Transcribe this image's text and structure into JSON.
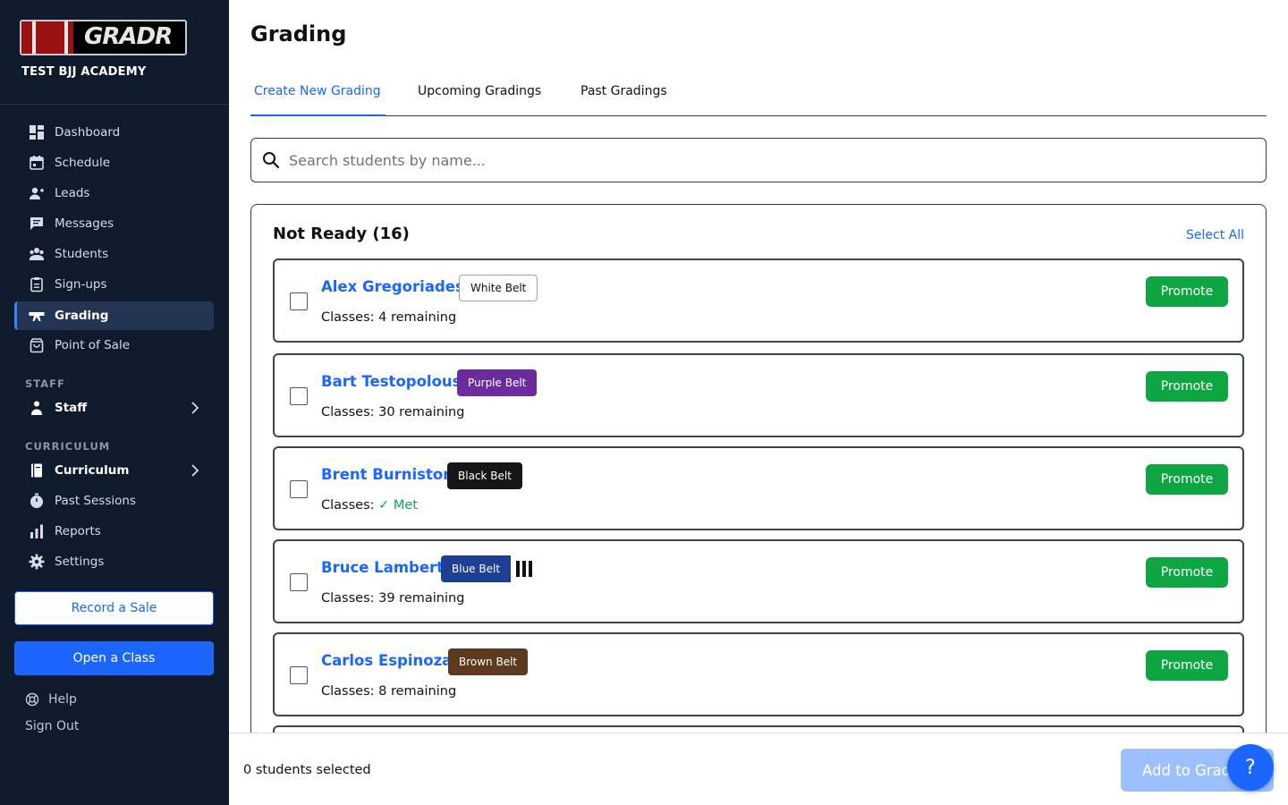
{
  "brand": {
    "logo_text": "GRADR",
    "academy": "TEST BJJ ACADEMY"
  },
  "sidebar": {
    "items": [
      {
        "label": "Dashboard",
        "icon": "dashboard-icon"
      },
      {
        "label": "Schedule",
        "icon": "calendar-icon"
      },
      {
        "label": "Leads",
        "icon": "add-person-icon"
      },
      {
        "label": "Messages",
        "icon": "message-icon"
      },
      {
        "label": "Students",
        "icon": "students-icon"
      },
      {
        "label": "Sign-ups",
        "icon": "clipboard-icon"
      },
      {
        "label": "Grading",
        "icon": "belt-icon",
        "active": true
      },
      {
        "label": "Point of Sale",
        "icon": "shopping-bag-icon"
      }
    ],
    "staff_section": "STAFF",
    "staff_item": "Staff",
    "curriculum_section": "CURRICULUM",
    "curriculum_items": [
      {
        "label": "Curriculum",
        "icon": "book-icon"
      },
      {
        "label": "Past Sessions",
        "icon": "stopwatch-icon"
      },
      {
        "label": "Reports",
        "icon": "bar-chart-icon"
      },
      {
        "label": "Settings",
        "icon": "gear-icon"
      }
    ],
    "record_sale": "Record a Sale",
    "open_class": "Open a Class",
    "help": "Help",
    "sign_out": "Sign Out"
  },
  "main": {
    "title": "Grading",
    "tabs": [
      {
        "label": "Create New Grading",
        "active": true
      },
      {
        "label": "Upcoming Gradings"
      },
      {
        "label": "Past Gradings"
      }
    ],
    "search_placeholder": "Search students by name...",
    "panel_title": "Not Ready (16)",
    "select_all": "Select All",
    "students": [
      {
        "name": "Alex Gregoriades",
        "belt": "White Belt",
        "classes_label": "Classes:",
        "classes_value": "4 remaining",
        "promote": "Promote"
      },
      {
        "name": "Bart Testopolous",
        "belt": "Purple Belt",
        "classes_label": "Classes:",
        "classes_value": "30 remaining",
        "promote": "Promote"
      },
      {
        "name": "Brent Burniston",
        "belt": "Black Belt",
        "classes_label": "Classes:",
        "classes_value": "✓ Met",
        "promote": "Promote"
      },
      {
        "name": "Bruce Lambert",
        "belt": "Blue Belt",
        "stripes": 3,
        "classes_label": "Classes:",
        "classes_value": "39 remaining",
        "promote": "Promote"
      },
      {
        "name": "Carlos Espinoza",
        "belt": "Brown Belt",
        "classes_label": "Classes:",
        "classes_value": "8 remaining",
        "promote": "Promote"
      }
    ]
  },
  "footer": {
    "selected_count": "0 students selected",
    "add_button": "Add to Grading",
    "help_fab": "?"
  },
  "colors": {
    "accent": "#1a66ff",
    "sidebar_bg": "#0f1b2d",
    "promote": "#0ea642",
    "white_belt": "#ffffff",
    "purple_belt": "#6b2a9e",
    "black_belt": "#161616",
    "blue_belt": "#1d3f96",
    "brown_belt": "#5b3a1f"
  }
}
